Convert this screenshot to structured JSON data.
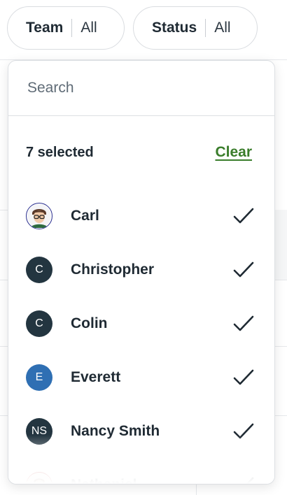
{
  "filters": {
    "team": {
      "label": "Team",
      "value": "All"
    },
    "status": {
      "label": "Status",
      "value": "All"
    }
  },
  "dropdown": {
    "search": {
      "placeholder": "Search",
      "value": ""
    },
    "selected_count": "7 selected",
    "clear_label": "Clear",
    "items": [
      {
        "name": "Carl",
        "avatar_type": "photo",
        "initials": "",
        "avatar_color": "#ffffff",
        "checked": true
      },
      {
        "name": "Christopher",
        "avatar_type": "initials",
        "initials": "C",
        "avatar_color": "#233540",
        "checked": true
      },
      {
        "name": "Colin",
        "avatar_type": "initials",
        "initials": "C",
        "avatar_color": "#233540",
        "checked": true
      },
      {
        "name": "Everett",
        "avatar_type": "initials",
        "initials": "E",
        "avatar_color": "#2f6fb3",
        "checked": true
      },
      {
        "name": "Nancy Smith",
        "avatar_type": "initials",
        "initials": "NS",
        "avatar_color": "#233540",
        "checked": true
      },
      {
        "name": "Nathaniel",
        "avatar_type": "photo",
        "initials": "",
        "avatar_color": "#ffffff",
        "checked": true
      }
    ]
  },
  "colors": {
    "accent_link": "#3a7d2b",
    "text_primary": "#1f2a33",
    "check": "#1f2a33"
  },
  "icons": {
    "check": "check-icon",
    "avatar_photo": "person-photo-icon"
  }
}
